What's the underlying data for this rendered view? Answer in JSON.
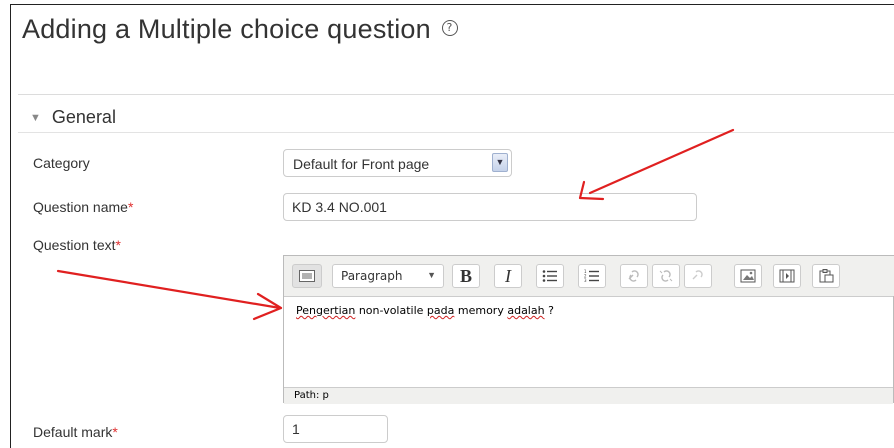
{
  "page": {
    "title": "Adding a Multiple choice question",
    "help_icon": "help-icon"
  },
  "section": {
    "title": "General",
    "toggle_icon": "triangle-down-icon"
  },
  "form": {
    "category_label": "Category",
    "category_value": "Default for Front page",
    "question_name_label": "Question name",
    "question_name_value": "KD 3.4 NO.001",
    "question_text_label": "Question text",
    "default_mark_label": "Default mark",
    "default_mark_value": "1",
    "required_marker": "*"
  },
  "editor": {
    "block_format": "Paragraph",
    "content": "Pengertian non-volatile pada memory adalah ?",
    "content_parts": [
      "Pengertian",
      " non-volatile ",
      "pada",
      " memory ",
      "adalah",
      " ?"
    ],
    "path_label": "Path: p",
    "toolbar_icons": [
      "toolbar-toggle-icon",
      "bold-icon",
      "italic-icon",
      "unordered-list-icon",
      "ordered-list-icon",
      "link-icon",
      "unlink-icon",
      "anchor-icon",
      "image-icon",
      "media-icon",
      "paste-icon"
    ]
  },
  "colors": {
    "required": "#e03030",
    "annotation_arrow": "#e02020"
  }
}
